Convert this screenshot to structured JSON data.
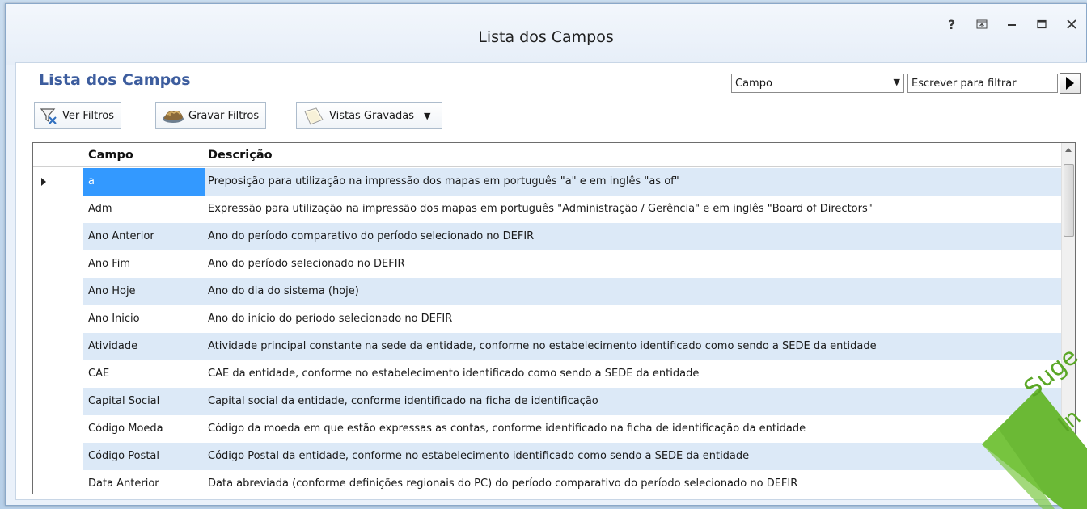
{
  "window": {
    "title": "Lista dos Campos",
    "controls": [
      "?",
      "⊼",
      "—",
      "☐",
      "✕"
    ]
  },
  "panel": {
    "title": "Lista dos Campos",
    "filter_field_selected": "Campo",
    "filter_input_placeholder": "Escrever para filtrar"
  },
  "toolbar": {
    "ver_filtros": "Ver Filtros",
    "gravar_filtros": "Gravar Filtros",
    "vistas_gravadas": "Vistas Gravadas"
  },
  "grid": {
    "columns": [
      "Campo",
      "Descrição"
    ],
    "rows": [
      {
        "campo": "a",
        "descricao": "Preposição para utilização na impressão dos mapas em português \"a\" e em inglês \"as of\""
      },
      {
        "campo": "Adm",
        "descricao": "Expressão para utilização na impressão dos mapas em português \"Administração / Gerência\" e em inglês \"Board of Directors\""
      },
      {
        "campo": "Ano Anterior",
        "descricao": "Ano do período comparativo do período selecionado no DEFIR"
      },
      {
        "campo": "Ano Fim",
        "descricao": "Ano do período selecionado no DEFIR"
      },
      {
        "campo": "Ano Hoje",
        "descricao": "Ano do dia do sistema (hoje)"
      },
      {
        "campo": "Ano Inicio",
        "descricao": "Ano do início do período selecionado no DEFIR"
      },
      {
        "campo": "Atividade",
        "descricao": "Atividade principal constante na sede da entidade, conforme no estabelecimento identificado como sendo a SEDE da entidade"
      },
      {
        "campo": "CAE",
        "descricao": "CAE da entidade, conforme no estabelecimento identificado como sendo a SEDE da entidade"
      },
      {
        "campo": "Capital Social",
        "descricao": "Capital social da entidade, conforme identificado na ficha de identificação"
      },
      {
        "campo": "Código Moeda",
        "descricao": "Código da moeda em que estão expressas as contas, conforme identificado na ficha de identificação da entidade"
      },
      {
        "campo": "Código Postal",
        "descricao": "Código Postal da entidade, conforme no estabelecimento identificado como sendo a SEDE da entidade"
      },
      {
        "campo": "Data Anterior",
        "descricao": "Data abreviada (conforme definições regionais do PC) do período comparativo do período selecionado no DEFIR"
      }
    ],
    "selected_row": 0
  },
  "ribbon": {
    "text_1": "Suge",
    "text_2": "In"
  },
  "colors": {
    "panel_title": "#3d5d9e",
    "row_alt": "#dce9f7",
    "selection": "#3399ff",
    "ribbon_green": "#6bb935"
  }
}
